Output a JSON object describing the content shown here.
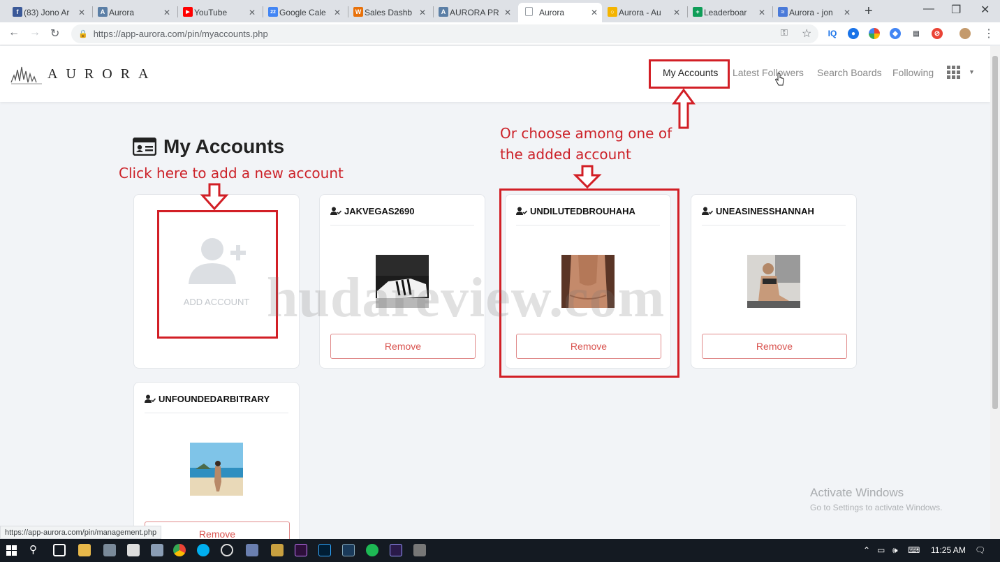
{
  "browser": {
    "tabs": [
      {
        "label": "(83) Jono Ar",
        "fav_color": "#3b5998",
        "fav": "f"
      },
      {
        "label": "Aurora",
        "fav_color": "#5b7fa6",
        "fav": "A"
      },
      {
        "label": "YouTube",
        "fav_color": "#ff0000",
        "fav": "▶"
      },
      {
        "label": "Google Cale",
        "fav_color": "#4285f4",
        "fav": "22"
      },
      {
        "label": "Sales Dashb",
        "fav_color": "#e8710a",
        "fav": "W"
      },
      {
        "label": "AURORA PR",
        "fav_color": "#5b7fa6",
        "fav": "A"
      },
      {
        "label": "Aurora",
        "fav_color": "#9aa0a6",
        "fav": ""
      },
      {
        "label": "Aurora - Au",
        "fav_color": "#f4b400",
        "fav": "○"
      },
      {
        "label": "Leaderboar",
        "fav_color": "#0f9d58",
        "fav": "+"
      },
      {
        "label": "Aurora - jon",
        "fav_color": "#4a7ad9",
        "fav": "≈"
      }
    ],
    "url": "https://app-aurora.com/pin/myaccounts.php",
    "status_url": "https://app-aurora.com/pin/management.php"
  },
  "app": {
    "logo_text": "AURORA",
    "nav": {
      "my_accounts": "My Accounts",
      "latest_followers": "Latest Followers",
      "search_boards": "Search Boards",
      "following": "Following"
    }
  },
  "page": {
    "title": "My Accounts",
    "add_account_label": "ADD ACCOUNT",
    "remove_label": "Remove",
    "accounts": [
      {
        "username": "JAKVEGAS2690"
      },
      {
        "username": "UNDILUTEDBROUHAHA"
      },
      {
        "username": "UNEASINESSHANNAH"
      },
      {
        "username": "UNFOUNDEDARBITRARY"
      }
    ]
  },
  "annotations": {
    "add_hint": "Click here to add a new account",
    "choose_hint_line1": "Or choose among one of",
    "choose_hint_line2": "the added account"
  },
  "watermark": "hudareview.com",
  "windows_activation": {
    "title": "Activate Windows",
    "subtitle": "Go to Settings to activate Windows."
  },
  "taskbar": {
    "time": "11:25 AM"
  },
  "colors": {
    "annotation_red": "#d21f26",
    "remove_text": "#d9534f"
  }
}
